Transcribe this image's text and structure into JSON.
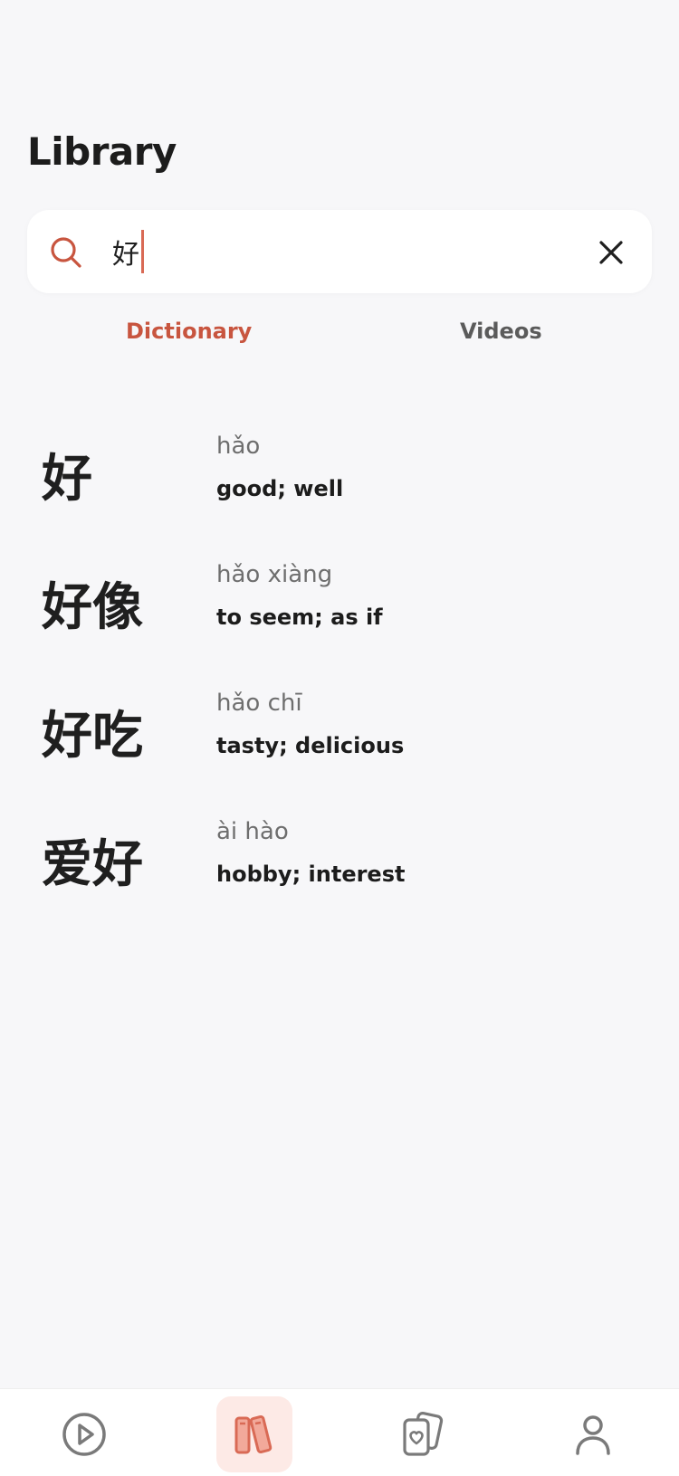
{
  "header": {
    "title": "Library"
  },
  "search": {
    "value": "好"
  },
  "tabs": [
    {
      "label": "Dictionary",
      "active": true
    },
    {
      "label": "Videos",
      "active": false
    }
  ],
  "results": [
    {
      "hanzi": "好",
      "pinyin": "hǎo",
      "definition": "good; well"
    },
    {
      "hanzi": "好像",
      "pinyin": "hǎo xiàng",
      "definition": "to seem; as if"
    },
    {
      "hanzi": "好吃",
      "pinyin": "hǎo chī",
      "definition": "tasty; delicious"
    },
    {
      "hanzi": "爱好",
      "pinyin": "ài hào",
      "definition": "hobby; interest"
    }
  ],
  "bottom_nav": [
    {
      "icon": "play-circle-icon",
      "active": false
    },
    {
      "icon": "books-icon",
      "active": true
    },
    {
      "icon": "flashcards-icon",
      "active": false
    },
    {
      "icon": "profile-icon",
      "active": false
    }
  ],
  "colors": {
    "accent": "#c8553f",
    "accent_light": "#fdeae6",
    "background": "#f7f7f9"
  }
}
